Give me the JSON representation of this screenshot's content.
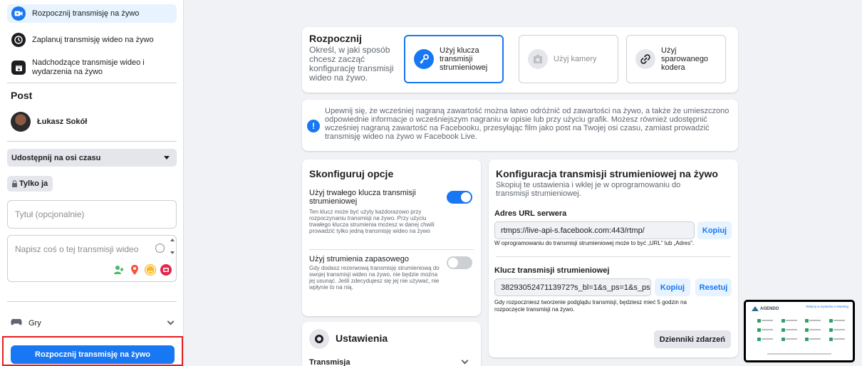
{
  "sidebar": {
    "nav": [
      {
        "label": "Rozpocznij transmisję na żywo",
        "icon": "live-video-icon",
        "active": true
      },
      {
        "label": "Zaplanuj transmisję wideo na żywo",
        "icon": "clock-icon"
      },
      {
        "label": "Nadchodzące transmisje wideo i wydarzenia na żywo",
        "icon": "calendar-icon"
      }
    ],
    "post_heading": "Post",
    "user_name": "Łukasz Sokół",
    "share_select": "Udostępnij na osi czasu",
    "privacy": "Tylko ja",
    "title_placeholder": "Tytuł (opcjonalnie)",
    "description_placeholder": "Napisz coś o tej transmisji wideo na żywo...",
    "games_label": "Gry",
    "start_button": "Rozpocznij transmisję na żywo"
  },
  "start": {
    "title": "Rozpocznij",
    "subtitle": "Określ, w jaki sposób chcesz zacząć konfigurację transmisji wideo na żywo.",
    "options": [
      {
        "label": "Użyj klucza transmisji strumieniowej",
        "icon": "key-icon",
        "selected": true
      },
      {
        "label": "Użyj kamery",
        "icon": "camera-icon",
        "disabled": true
      },
      {
        "label": "Użyj sparowanego kodera",
        "icon": "link-icon"
      }
    ]
  },
  "notice": {
    "text": "Upewnij się, że wcześniej nagraną zawartość można łatwo odróżnić od zawartości na żywo, a także że umieszczono odpowiednie informacje o wcześniejszym nagraniu w opisie lub przy użyciu grafik. Możesz również udostępnić wcześniej nagraną zawartość na Facebooku, przesyłając film jako post na Twojej osi czasu, zamiast prowadzić transmisję wideo na żywo w Facebook Live."
  },
  "configure": {
    "title": "Skonfiguruj opcje",
    "persistent_key": {
      "title": "Użyj trwałego klucza transmisji strumieniowej",
      "desc": "Ten klucz może być użyty każdorazowo przy rozpoczynaniu transmisji na żywo. Przy użyciu trwałego klucza strumienia możesz w danej chwili prowadzić tylko jedną transmisję wideo na żywo",
      "enabled": true
    },
    "backup_stream": {
      "title": "Użyj strumienia zapasowego",
      "desc": "Gdy dodasz rezerwową transmisję strumieniową do swojej transmisji wideo na żywo, nie będzie można jej usunąć. Jeśli zdecydujesz się jej nie używać, nie wpłynie to na nią.",
      "enabled": false
    }
  },
  "settings": {
    "title": "Ustawienia",
    "row_label": "Transmisja"
  },
  "stream_config": {
    "title": "Konfiguracja transmisji strumieniowej na żywo",
    "subtitle": "Skopiuj te ustawienia i wklej je w oprogramowaniu do transmisji strumieniowej.",
    "server_label": "Adres URL serwera",
    "server_url": "rtmps://live-api-s.facebook.com:443/rtmp/",
    "copy": "Kopiuj",
    "server_note": "W oprogramowaniu do transmisji strumieniowej może to być „URL” lub „Adres”.",
    "key_label": "Klucz transmisji strumieniowej",
    "key_value": "3829305247113972?s_bl=1&s_ps=1&s_psm=1",
    "reset": "Resetuj",
    "key_note": "Gdy rozpoczniesz tworzenie podglądu transmisji, będziesz mieć 5 godzin na rozpoczęcie transmisji na żywo.",
    "event_logs": "Dzienniki zdarzeń"
  },
  "pip": {
    "logo": "AGENDO",
    "header": "Witamy w systemie e-Meeting"
  },
  "colors": {
    "accent": "#1877f2",
    "highlight_border": "#e41e1e"
  }
}
